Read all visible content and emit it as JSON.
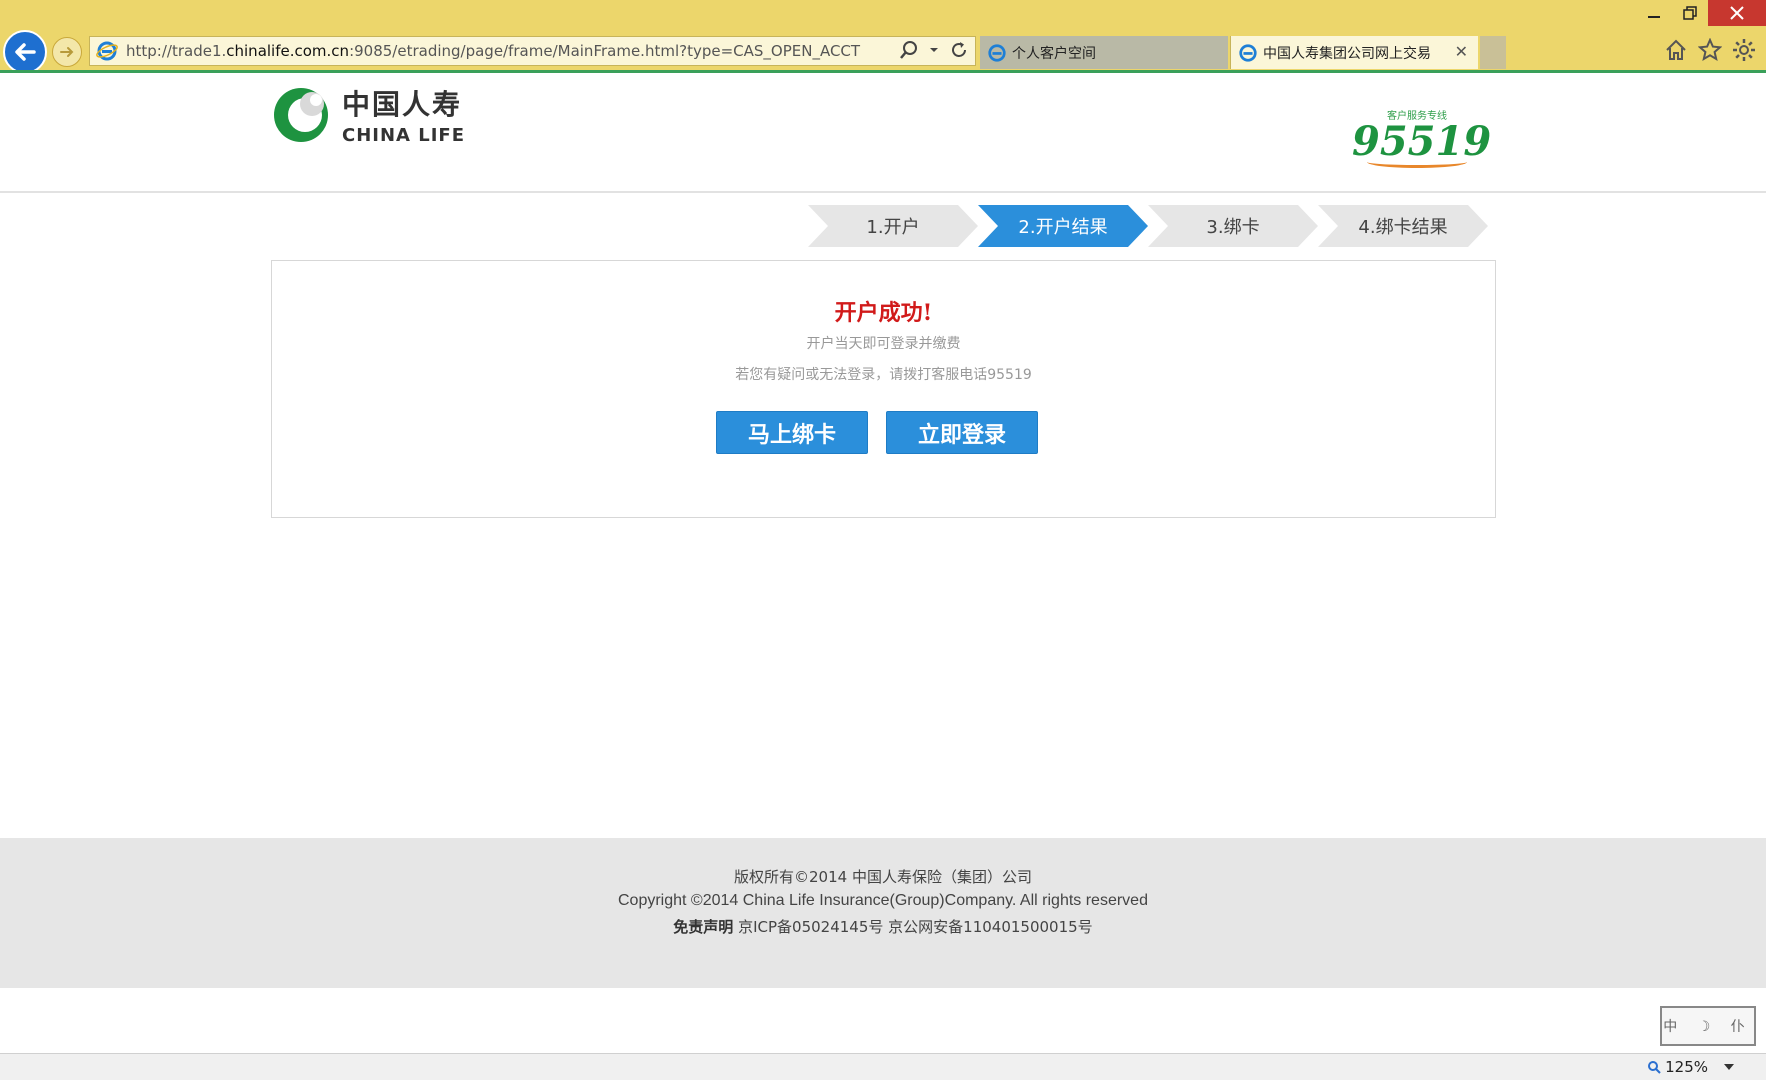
{
  "browser": {
    "url_prefix": "http://trade1.",
    "url_domain": "chinalife.com.cn",
    "url_suffix": ":9085/etrading/page/frame/MainFrame.html?type=CAS_OPEN_ACCT",
    "tabs": [
      {
        "label": "个人客户空间"
      },
      {
        "label": "中国人寿集团公司网上交易"
      }
    ],
    "zoom": "125%"
  },
  "header": {
    "logo_cn": "中国人寿",
    "logo_en": "CHINA LIFE",
    "hotline_label": "客户服务专线",
    "hotline_number": "95519"
  },
  "steps": [
    {
      "label": "1.开户",
      "active": false
    },
    {
      "label": "2.开户结果",
      "active": true
    },
    {
      "label": "3.绑卡",
      "active": false
    },
    {
      "label": "4.绑卡结果",
      "active": false
    }
  ],
  "result": {
    "title": "开户成功!",
    "line1": "开户当天即可登录并缴费",
    "line2": "若您有疑问或无法登录，请拨打客服电话95519",
    "bind_button": "马上绑卡",
    "login_button": "立即登录"
  },
  "footer": {
    "copyright_cn": "版权所有©2014 中国人寿保险（集团）公司",
    "copyright_en": "Copyright ©2014 China Life Insurance(Group)Company. All rights reserved",
    "disclaimer": "免责声明",
    "icp": "京ICP备05024145号 京公网安备110401500015号"
  },
  "colors": {
    "brand_green": "#1e9340",
    "step_active": "#2b8fdb",
    "success_red": "#d11a1a"
  }
}
